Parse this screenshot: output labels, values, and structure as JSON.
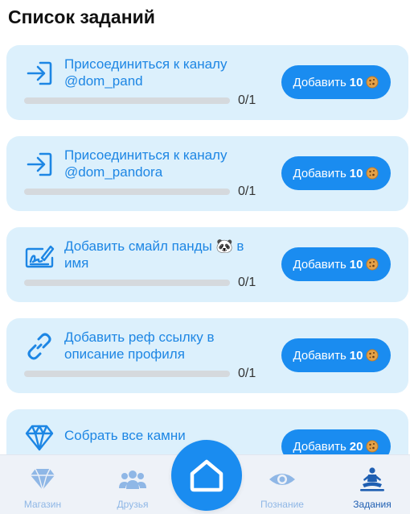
{
  "page": {
    "title": "Список заданий"
  },
  "colors": {
    "accent": "#1a8cf0",
    "card_bg": "#dcf0fc",
    "task_text": "#1d86e4",
    "nav_inactive": "#8fb7e6",
    "nav_active": "#1f5fb2"
  },
  "tasks": [
    {
      "icon": "enter-icon",
      "title": "Присоединиться к каналу @dom_pand",
      "progress_text": "0/1",
      "progress": 0,
      "button_label": "Добавить",
      "reward": "10",
      "reward_icon": "cookie-icon"
    },
    {
      "icon": "enter-icon",
      "title": "Присоединиться к каналу @dom_pandora",
      "progress_text": "0/1",
      "progress": 0,
      "button_label": "Добавить",
      "reward": "10",
      "reward_icon": "cookie-icon"
    },
    {
      "icon": "signature-icon",
      "title": "Добавить смайл панды 🐼 в имя",
      "progress_text": "0/1",
      "progress": 0,
      "button_label": "Добавить",
      "reward": "10",
      "reward_icon": "cookie-icon"
    },
    {
      "icon": "link-icon",
      "title": "Добавить реф ссылку в описание профиля",
      "progress_text": "0/1",
      "progress": 0,
      "button_label": "Добавить",
      "reward": "10",
      "reward_icon": "cookie-icon"
    },
    {
      "icon": "diamond-icon",
      "title": "Собрать все камни",
      "progress_text": "",
      "progress": 0,
      "button_label": "Добавить",
      "reward": "20",
      "reward_icon": "cookie-icon"
    }
  ],
  "nav": {
    "items": [
      {
        "label": "Магазин",
        "icon": "diamond-icon"
      },
      {
        "label": "Друзья",
        "icon": "users-icon"
      },
      {
        "label": "Познание",
        "icon": "eye-icon"
      },
      {
        "label": "Задания",
        "icon": "meditation-icon",
        "active": true
      }
    ],
    "home_icon": "home-icon"
  }
}
